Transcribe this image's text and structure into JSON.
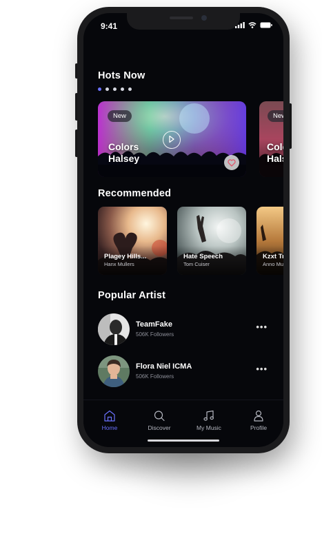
{
  "status_bar": {
    "time": "9:41"
  },
  "hots_now": {
    "title": "Hots Now",
    "cards": [
      {
        "badge": "New",
        "line1": "Colors",
        "line2": "Halsey"
      },
      {
        "badge": "New",
        "line1": "Colors",
        "line2": "Halsey"
      }
    ]
  },
  "recommended": {
    "title": "Recommended",
    "cards": [
      {
        "title": "Plagey Hills...",
        "subtitle": "Hanx Mullers"
      },
      {
        "title": "Hate Speech",
        "subtitle": "Tom Cuiser"
      },
      {
        "title": "Kzxt Tr",
        "subtitle": "Anno Mu"
      }
    ]
  },
  "popular_artist": {
    "title": "Popular Artist",
    "artists": [
      {
        "name": "TeamFake",
        "followers": "506K Followers"
      },
      {
        "name": "Flora Niel ICMA",
        "followers": "506K Followers"
      }
    ]
  },
  "tab_bar": {
    "tabs": [
      {
        "label": "Home",
        "icon": "home-icon",
        "active": true
      },
      {
        "label": "Discover",
        "icon": "search-icon",
        "active": false
      },
      {
        "label": "My Music",
        "icon": "music-note-icon",
        "active": false
      },
      {
        "label": "Profile",
        "icon": "user-icon",
        "active": false
      }
    ]
  },
  "colors": {
    "accent": "#6b72ff",
    "background": "#06070b"
  }
}
